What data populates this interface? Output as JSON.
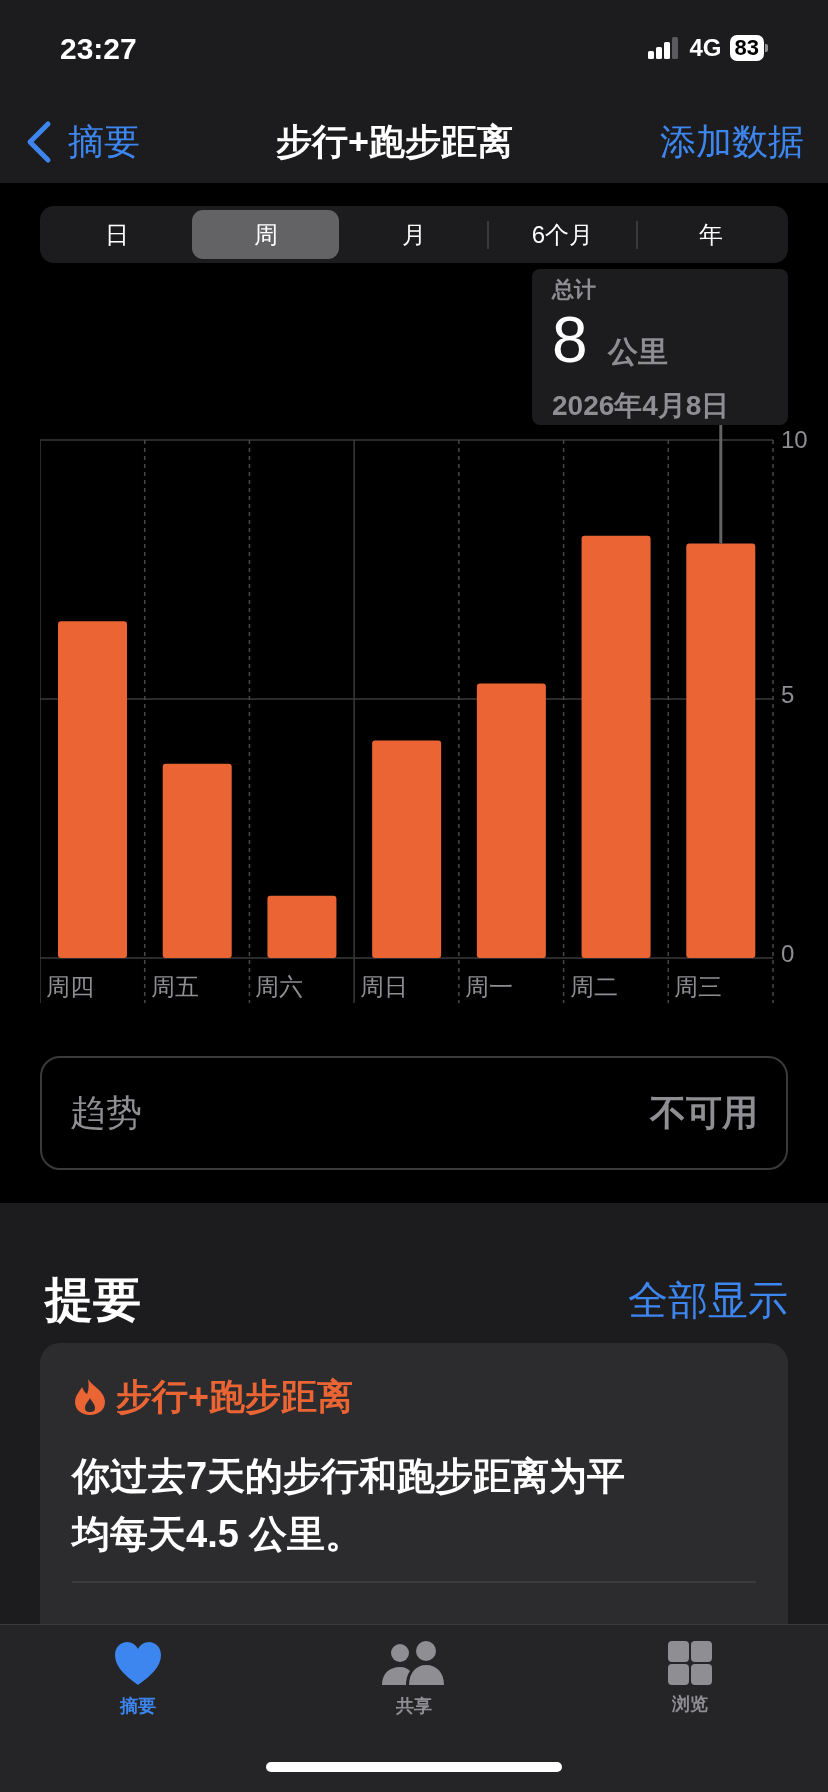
{
  "status_bar": {
    "time": "23:27",
    "network": "4G",
    "battery": "83"
  },
  "nav": {
    "back": "摘要",
    "title": "步行+跑步距离",
    "action": "添加数据"
  },
  "segments": [
    {
      "label": "日",
      "selected": false
    },
    {
      "label": "周",
      "selected": true
    },
    {
      "label": "月",
      "selected": false
    },
    {
      "label": "6个月",
      "selected": false
    },
    {
      "label": "年",
      "selected": false
    }
  ],
  "tooltip": {
    "label": "总计",
    "value": "8",
    "unit": "公里",
    "date": "2026年4月8日"
  },
  "chart_data": {
    "type": "bar",
    "categories": [
      "周四",
      "周五",
      "周六",
      "周日",
      "周一",
      "周二",
      "周三"
    ],
    "series": [
      {
        "color": "#eb6534",
        "values": [
          6.5,
          3.75,
          1.2,
          4.2,
          5.3,
          8.15,
          8.0
        ]
      }
    ],
    "ylim": [
      0,
      10
    ],
    "yticks": [
      0,
      5,
      10
    ]
  },
  "trend": {
    "label": "趋势",
    "value": "不可用"
  },
  "highlights": {
    "title": "提要",
    "action": "全部显示",
    "card": {
      "title": "步行+跑步距离",
      "text": "你过去7天的步行和跑步距离为平均每天4.5 公里。"
    }
  },
  "tab_bar": [
    {
      "label": "摘要",
      "kind": "heart",
      "selected": true
    },
    {
      "label": "共享",
      "kind": "people",
      "selected": false
    },
    {
      "label": "浏览",
      "kind": "grid",
      "selected": false
    }
  ]
}
